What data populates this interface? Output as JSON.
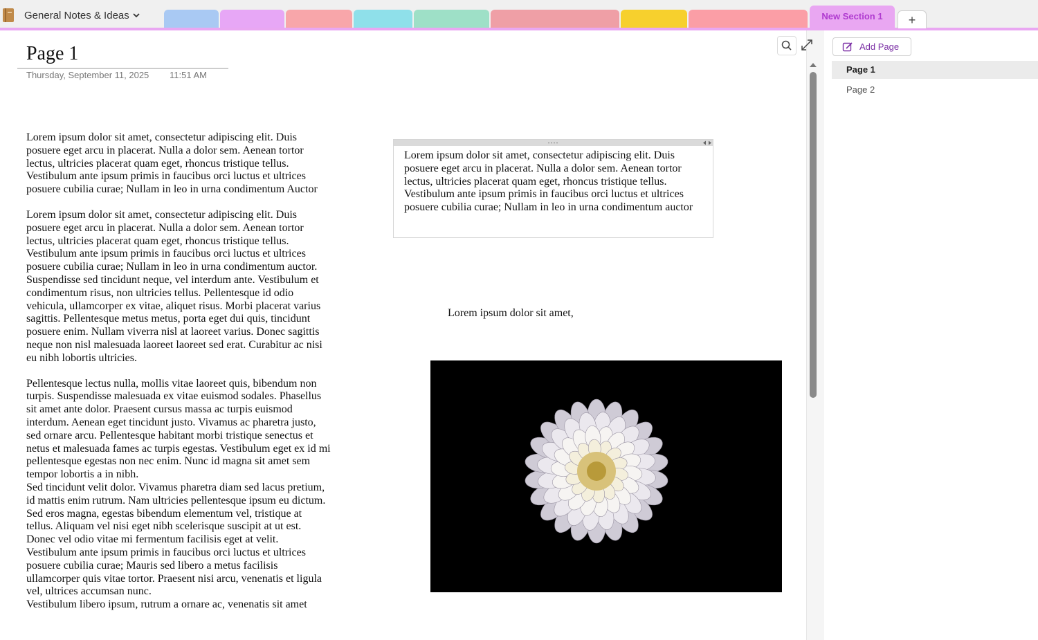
{
  "notebook": {
    "title": "General Notes & Ideas"
  },
  "tabs": {
    "colors": [
      "#a9c9f3",
      "#e7a7f6",
      "#f8a6aa",
      "#8fe0ea",
      "#9ee0c7",
      "#ef9fa6",
      "#f7d02d",
      "#fb9ea6"
    ],
    "active_label": "New Section 1",
    "active_color": "#e9a7f2",
    "add_label": "+"
  },
  "page": {
    "title": "Page 1",
    "date": "Thursday, September 11, 2025",
    "time": "11:51 AM"
  },
  "content": {
    "p1": "Lorem ipsum dolor sit amet, consectetur adipiscing elit. Duis posuere eget arcu in placerat. Nulla a dolor sem. Aenean tortor lectus, ultricies placerat quam eget, rhoncus tristique tellus. Vestibulum ante ipsum primis in faucibus orci luctus et ultrices posuere cubilia curae; Nullam in leo in urna condimentum Auctor",
    "p2": "Lorem ipsum dolor sit amet, consectetur adipiscing elit. Duis posuere eget arcu in placerat. Nulla a dolor sem. Aenean tortor lectus, ultricies placerat quam eget, rhoncus tristique tellus. Vestibulum ante ipsum primis in faucibus orci luctus et ultrices posuere cubilia curae; Nullam in leo in urna condimentum auctor. Suspendisse sed tincidunt neque, vel interdum ante. Vestibulum et condimentum risus, non ultricies tellus. Pellentesque id odio vehicula, ullamcorper ex vitae, aliquet risus. Morbi placerat varius sagittis. Pellentesque metus metus, porta eget dui quis, tincidunt posuere enim. Nullam viverra nisl at laoreet varius. Donec sagittis neque non nisl malesuada laoreet laoreet sed erat. Curabitur ac nisi eu nibh lobortis ultricies.",
    "p3": "Pellentesque lectus nulla, mollis vitae laoreet quis, bibendum non turpis. Suspendisse malesuada ex vitae euismod sodales. Phasellus sit amet ante dolor. Praesent cursus massa ac turpis euismod interdum. Aenean eget tincidunt justo. Vivamus ac pharetra justo, sed ornare arcu. Pellentesque habitant morbi tristique senectus et netus et malesuada fames ac turpis egestas. Vestibulum eget ex id mi pellentesque egestas non nec enim. Nunc id magna sit amet sem tempor lobortis a in nibh.",
    "p4": "Sed tincidunt velit dolor. Vivamus pharetra diam sed lacus pretium, id mattis enim rutrum. Nam ultricies pellentesque ipsum eu dictum. Sed eros magna, egestas bibendum elementum vel, tristique at tellus. Aliquam vel nisi eget nibh scelerisque suscipit at ut est. Donec vel odio vitae mi fermentum facilisis eget at velit. Vestibulum ante ipsum primis in faucibus orci luctus et ultrices posuere cubilia curae; Mauris sed libero a metus facilisis ullamcorper quis vitae tortor. Praesent nisi arcu, venenatis et ligula vel, ultrices accumsan nunc.",
    "p5": "Vestibulum libero ipsum, rutrum a ornare ac, venenatis sit amet",
    "box": "Lorem ipsum dolor sit amet, consectetur adipiscing elit. Duis posuere eget arcu in placerat. Nulla a dolor sem. Aenean tortor lectus, ultricies placerat quam eget, rhoncus tristique tellus. Vestibulum ante ipsum primis in faucibus orci luctus et ultrices posuere cubilia curae; Nullam in leo in urna condimentum auctor",
    "line": "Lorem ipsum dolor sit amet,"
  },
  "pages_pane": {
    "add_label": "Add Page",
    "pages": [
      "Page 1",
      "Page 2"
    ]
  },
  "icons": {
    "notebook": "notebook-icon",
    "chevron": "chevron-down-icon",
    "search": "search-icon",
    "expand": "expand-icon",
    "add_page": "add-page-icon",
    "scroll_up": "arrow-up-icon"
  }
}
